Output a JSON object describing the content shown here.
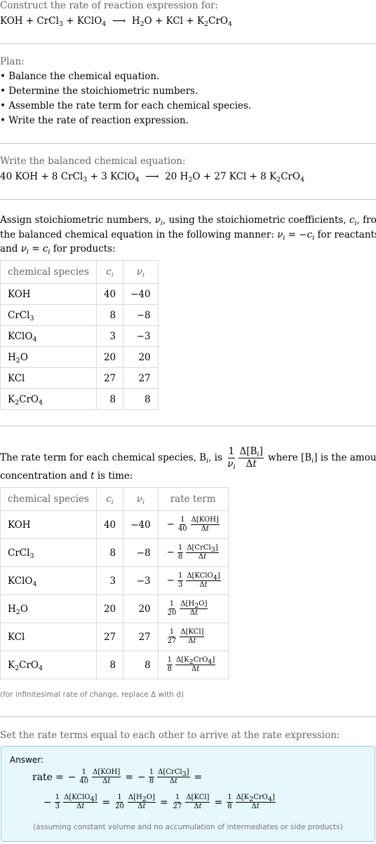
{
  "header": {
    "prompt": "Construct the rate of reaction expression for:",
    "reaction": {
      "reactants": [
        {
          "base": "KOH",
          "sub": ""
        },
        {
          "base": "CrCl",
          "sub": "3"
        },
        {
          "base": "KClO",
          "sub": "4"
        }
      ],
      "arrow": "⟶",
      "products": [
        {
          "parts": [
            "H",
            "2",
            "O"
          ]
        },
        {
          "parts": [
            "KCl"
          ]
        },
        {
          "parts": [
            "K",
            "2",
            "CrO",
            "4"
          ]
        }
      ]
    }
  },
  "plan": {
    "title": "Plan:",
    "steps": [
      "• Balance the chemical equation.",
      "• Determine the stoichiometric numbers.",
      "• Assemble the rate term for each chemical species.",
      "• Write the rate of reaction expression."
    ]
  },
  "balanced": {
    "title": "Write the balanced chemical equation:",
    "coefficients": [
      "40",
      "8",
      "3",
      "20",
      "27",
      "8"
    ]
  },
  "stoich": {
    "intro_1": "Assign stoichiometric numbers, ",
    "intro_2": ", using the stoichiometric coefficients, ",
    "intro_3": ", from",
    "intro_line2": "the balanced chemical equation in the following manner: ",
    "intro_line2b": " for reactants",
    "intro_line3": "and ",
    "intro_line3b": " for products:",
    "headers": [
      "chemical species",
      "c",
      "ν"
    ],
    "rows": [
      {
        "species": "KOH",
        "c": "40",
        "v": "−40"
      },
      {
        "species": "CrCl3",
        "c": "8",
        "v": "−8"
      },
      {
        "species": "KClO4",
        "c": "3",
        "v": "−3"
      },
      {
        "species": "H2O",
        "c": "20",
        "v": "20"
      },
      {
        "species": "KCl",
        "c": "27",
        "v": "27"
      },
      {
        "species": "K2CrO4",
        "c": "8",
        "v": "8"
      }
    ]
  },
  "rate_terms": {
    "intro_1": "The rate term for each chemical species, B",
    "intro_2": ", is",
    "intro_3": "where [B",
    "intro_4": "] is the amount",
    "intro_line2a": "concentration and ",
    "intro_line2b": " is time:",
    "headers": [
      "chemical species",
      "c",
      "ν",
      "rate term"
    ],
    "rows": [
      {
        "species": "KOH",
        "c": "40",
        "v": "−40",
        "sign": "−",
        "den": "40",
        "conc": "KOH"
      },
      {
        "species": "CrCl3",
        "c": "8",
        "v": "−8",
        "sign": "−",
        "den": "8",
        "conc": "CrCl3"
      },
      {
        "species": "KClO4",
        "c": "3",
        "v": "−3",
        "sign": "−",
        "den": "3",
        "conc": "KClO4"
      },
      {
        "species": "H2O",
        "c": "20",
        "v": "20",
        "sign": "",
        "den": "20",
        "conc": "H2O"
      },
      {
        "species": "KCl",
        "c": "27",
        "v": "27",
        "sign": "",
        "den": "27",
        "conc": "KCl"
      },
      {
        "species": "K2CrO4",
        "c": "8",
        "v": "8",
        "sign": "",
        "den": "8",
        "conc": "K2CrO4"
      }
    ],
    "note": "(for infinitesimal rate of change, replace Δ with d)"
  },
  "final": {
    "title": "Set the rate terms equal to each other to arrive at the rate expression:",
    "answer_label": "Answer:",
    "rate_word": "rate",
    "note": "(assuming constant volume and no accumulation of intermediates or side products)"
  }
}
